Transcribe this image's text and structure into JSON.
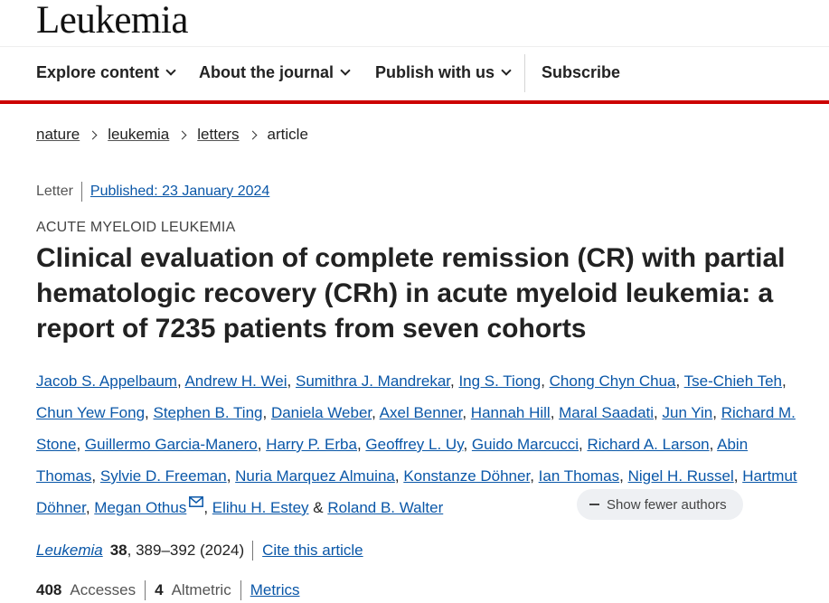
{
  "journal": {
    "title": "Leukemia"
  },
  "nav": {
    "explore": "Explore content",
    "about": "About the journal",
    "publish": "Publish with us",
    "subscribe": "Subscribe"
  },
  "breadcrumb": [
    "nature",
    "leukemia",
    "letters",
    "article"
  ],
  "article": {
    "type": "Letter",
    "published": "Published: 23 January 2024",
    "subject": "ACUTE MYELOID LEUKEMIA",
    "title": "Clinical evaluation of complete remission (CR) with partial hematologic recovery (CRh) in acute myeloid leukemia: a report of 7235 patients from seven cohorts"
  },
  "authors": [
    "Jacob S. Appelbaum",
    "Andrew H. Wei",
    "Sumithra J. Mandrekar",
    "Ing S. Tiong",
    "Chong Chyn Chua",
    "Tse-Chieh Teh",
    "Chun Yew Fong",
    "Stephen B. Ting",
    "Daniela Weber",
    "Axel Benner",
    "Hannah Hill",
    "Maral Saadati",
    "Jun Yin",
    "Richard M. Stone",
    "Guillermo Garcia-Manero",
    "Harry P. Erba",
    "Geoffrey L. Uy",
    "Guido Marcucci",
    "Richard A. Larson",
    "Abin Thomas",
    "Sylvie D. Freeman",
    "Nuria Marquez Almuina",
    "Konstanze Döhner",
    "Ian Thomas",
    "Nigel H. Russel",
    "Hartmut Döhner",
    "Megan Othus",
    "Elihu H. Estey",
    "Roland B. Walter"
  ],
  "show_fewer": "Show fewer authors",
  "citation": {
    "journal": "Leukemia",
    "volume": "38",
    "pages": ", 389–392 (2024)",
    "cite_link": "Cite this article"
  },
  "metrics": {
    "accesses_num": "408",
    "accesses_label": "Accesses",
    "altmetric_num": "4",
    "altmetric_label": "Altmetric",
    "metrics_link": "Metrics"
  },
  "colors": {
    "link": "#0a57a8",
    "accent_bar": "#cc0000"
  }
}
